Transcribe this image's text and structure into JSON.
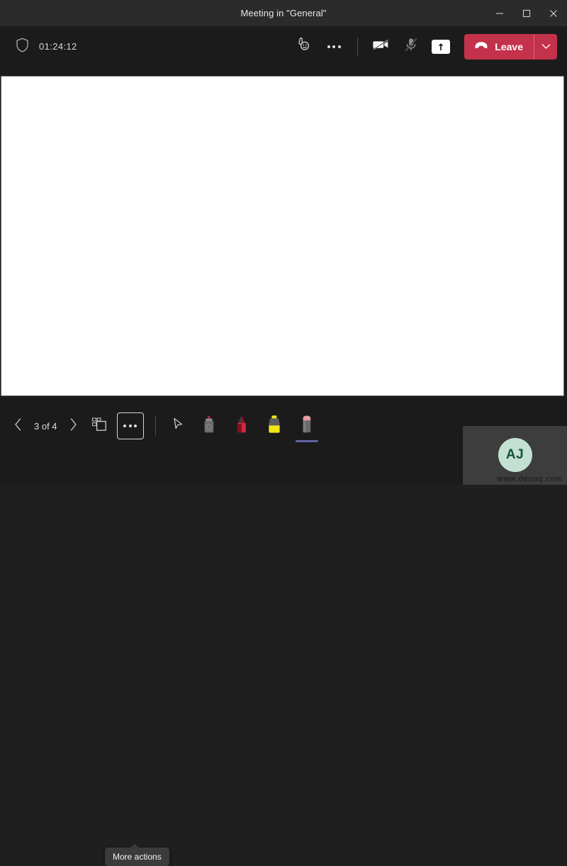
{
  "window": {
    "title": "Meeting in \"General\"",
    "controls": [
      {
        "name": "minimize",
        "glyph": "minimize-icon"
      },
      {
        "name": "maximize",
        "glyph": "maximize-icon"
      },
      {
        "name": "close",
        "glyph": "close-icon"
      }
    ]
  },
  "meeting_bar": {
    "shield_icon": "shield-icon",
    "timer": "01:24:12",
    "buttons": [
      {
        "name": "reactions",
        "label": "Reactions",
        "icon": "reactions-icon"
      },
      {
        "name": "more-options",
        "label": "More options",
        "icon": "ellipsis-icon"
      },
      {
        "name": "camera",
        "label": "Camera off",
        "icon": "camera-off-icon",
        "state": "off"
      },
      {
        "name": "microphone",
        "label": "Mic muted",
        "icon": "mic-muted-icon",
        "state": "muted"
      },
      {
        "name": "share",
        "label": "Stop sharing",
        "icon": "share-screen-icon",
        "state": "active"
      }
    ],
    "leave": {
      "label": "Leave",
      "icon": "hangup-icon",
      "caret_icon": "chevron-down-icon",
      "color": "#c4314b"
    }
  },
  "stage": {
    "content_type": "whiteboard",
    "background": "#ffffff"
  },
  "bottom_bar": {
    "prev_icon": "chevron-left-icon",
    "next_icon": "chevron-right-icon",
    "slide_count": "3 of 4",
    "layout_button": {
      "name": "slide-layout",
      "icon": "slide-layout-icon"
    },
    "more_actions_button": {
      "name": "more-actions",
      "icon": "ellipsis-icon",
      "focused": true
    },
    "tooltip": "More actions",
    "tools": [
      {
        "name": "pointer",
        "label": "Laser pointer",
        "icon": "cursor-icon",
        "selected": false
      },
      {
        "name": "black-pen",
        "label": "Black pen",
        "icon": "pen-icon",
        "body": "#6e6e6e",
        "tip": "#c0392b",
        "selected": false
      },
      {
        "name": "red-pen",
        "label": "Red pen",
        "icon": "pen-icon",
        "body": "#d1263c",
        "tip": "#8c1020",
        "selected": false
      },
      {
        "name": "yellow-highlighter",
        "label": "Yellow highlighter",
        "icon": "highlighter-icon",
        "body": "#f2e616",
        "tip": "#5a5a5a",
        "selected": false
      },
      {
        "name": "eraser",
        "label": "Eraser",
        "icon": "eraser-icon",
        "body": "#6a6a6a",
        "tip": "#e79aa0",
        "selected": true,
        "underline_color": "#6264a7"
      }
    ]
  },
  "participant_tile": {
    "initials": "AJ",
    "avatar_color": "#c3e1d2",
    "initials_color": "#13543a",
    "watermark": "www.deuaq.com"
  }
}
